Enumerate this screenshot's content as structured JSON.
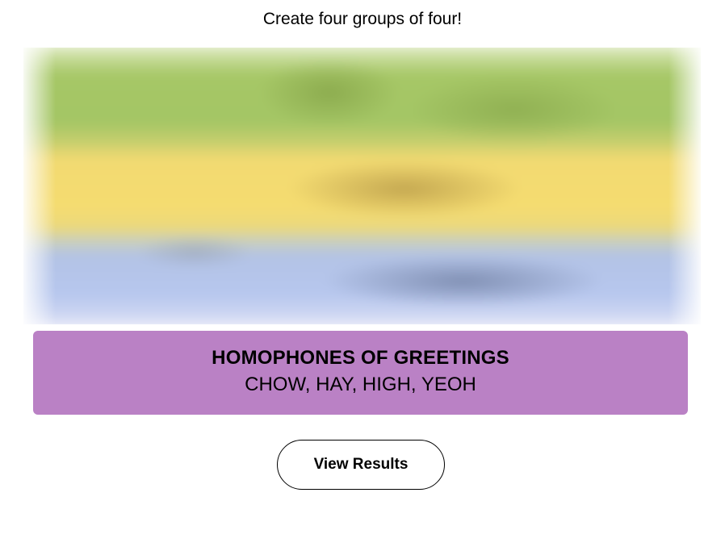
{
  "instructions": "Create four groups of four!",
  "solved_group": {
    "title": "HOMOPHONES OF GREETINGS",
    "words": "CHOW, HAY, HIGH, YEOH",
    "color": "#ba81c5"
  },
  "hidden_groups_colors": [
    "#a0c35a",
    "#f9df6d",
    "#b0c4ef"
  ],
  "actions": {
    "view_results_label": "View Results"
  }
}
